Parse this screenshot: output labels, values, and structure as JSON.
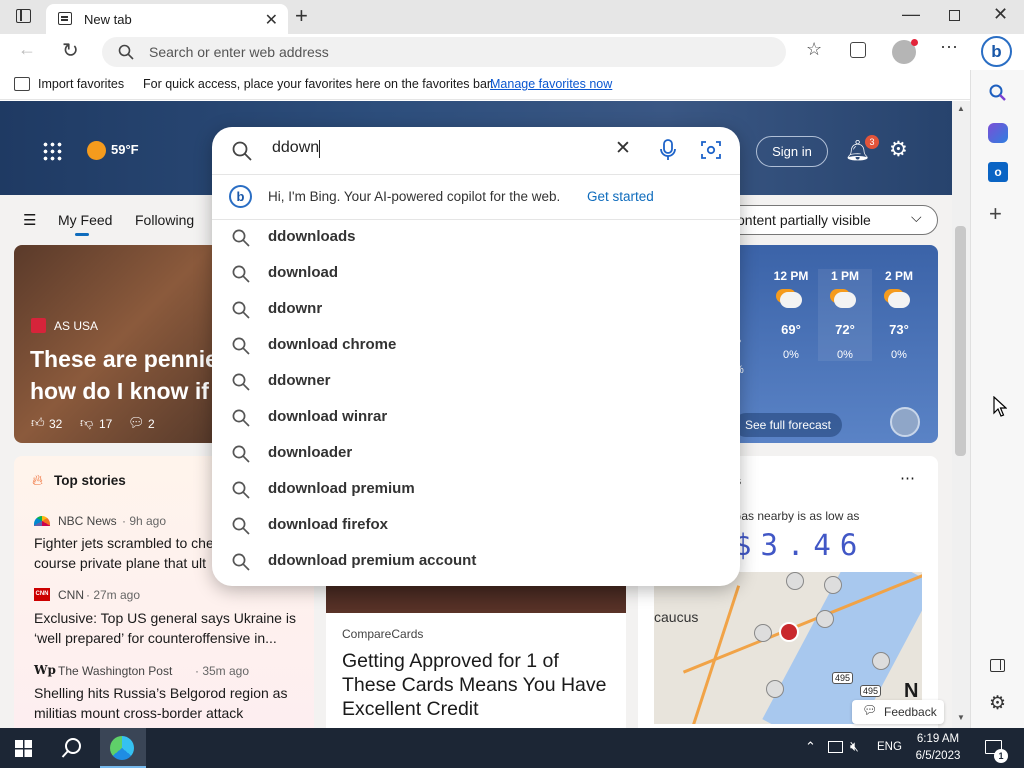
{
  "browser": {
    "tab_title": "New tab",
    "address_placeholder": "Search or enter web address"
  },
  "favorites_bar": {
    "import_label": "Import favorites",
    "message": "For quick access, place your favorites here on the favorites bar.",
    "manage_link": "Manage favorites now"
  },
  "header": {
    "weather_temp": "59°F",
    "sign_in": "Sign in",
    "notification_count": "3"
  },
  "feed_nav": {
    "my_feed": "My Feed",
    "following": "Following",
    "content_select": "ontent partially visible"
  },
  "search": {
    "query": "ddown",
    "bing_text": "Hi, I'm Bing. Your AI-powered copilot for the web.",
    "bing_link": "Get started",
    "suggestions": [
      "ddownloads",
      "download",
      "ddownr",
      "download chrome",
      "ddowner",
      "download winrar",
      "downloader",
      "ddownload premium",
      "download firefox",
      "ddownload premium account"
    ]
  },
  "hero_card": {
    "source": "AS USA",
    "headline": "These are pennie\nhow do I know if",
    "likes": "32",
    "dislikes": "17",
    "comments": "2"
  },
  "forecast": {
    "hours": [
      {
        "time": "12 PM",
        "temp": "69°",
        "precip": "0%"
      },
      {
        "time": "1 PM",
        "temp": "72°",
        "precip": "0%"
      },
      {
        "time": "2 PM",
        "temp": "73°",
        "precip": "0%"
      }
    ],
    "partial_temp": "°",
    "partial_precip": "%",
    "see_full": "See full forecast"
  },
  "top_stories": {
    "title": "Top stories",
    "items": [
      {
        "source": "NBC News",
        "time": "· 9h ago",
        "headline": "Fighter jets scrambled to che\ncourse private plane that ult"
      },
      {
        "source": "CNN",
        "time": "· 27m ago",
        "headline": "Exclusive: Top US general says Ukraine is\n‘well prepared’ for counteroffensive in..."
      },
      {
        "source": "The Washington Post",
        "time": "· 35m ago",
        "headline": "Shelling hits Russia’s Belgorod region as\nmilitias mount cross-border attack"
      }
    ]
  },
  "ad_card": {
    "source": "CompareCards",
    "headline": "Getting Approved for 1 of\nThese Cards Means You Have\nExcellent Credit"
  },
  "gas_card": {
    "title_partial": "s",
    "subtitle": "Gas nearby is as low as",
    "price": "$3.46",
    "map_label": "caucus",
    "map_road1": "495",
    "map_road2": "495",
    "map_letter": "N"
  },
  "feedback": "Feedback",
  "taskbar": {
    "language": "ENG",
    "time": "6:19 AM",
    "date": "6/5/2023",
    "notif_count": "1"
  },
  "colors": {
    "accent": "#0f6cbd",
    "hero_bg": "#2d4e7c",
    "taskbar_bg": "#1c2635",
    "notif_badge": "#e3543a"
  }
}
